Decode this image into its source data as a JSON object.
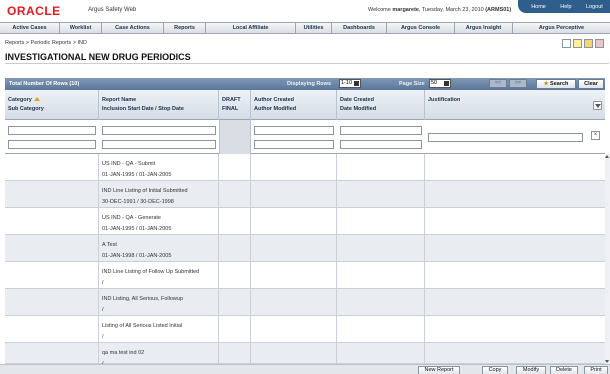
{
  "header": {
    "logo": "ORACLE",
    "app_name": "Argus Safety Web",
    "welcome_prefix": "Welcome ",
    "user": "margarete",
    "date": ", Tuesday, March 23, 2010 ",
    "site": "(ARMS01)",
    "links": [
      "Home",
      "Help",
      "Logout"
    ]
  },
  "menu": [
    "Active Cases",
    "Worklist",
    "Case Actions",
    "Reports",
    "Local Affiliate",
    "Utilities",
    "Dashboards",
    "Argus Console",
    "Argus Insight",
    "Argus Perceptive"
  ],
  "breadcrumb": "Reports > Periodic Reports > IND",
  "page_title": "INVESTIGATIONAL NEW DRUG PERIODICS",
  "grid": {
    "total": "Total Number Of Rows (10)",
    "displaying_label": "Displaying Rows",
    "displaying_value": "1-10",
    "page_size_label": "Page Size",
    "page_size_value": "50",
    "prev": "<<",
    "next": ">>",
    "search": "Search",
    "clear": "Clear",
    "columns": {
      "category": "Category",
      "sub_category": "Sub Category",
      "report_name": "Report Name",
      "inclusion": "Inclusion Start Date / Stop Date",
      "draft": "DRAFT",
      "final": "FINAL",
      "author_created": "Author Created",
      "author_modified": "Author Modified",
      "date_created": "Date Created",
      "date_modified": "Date Modified",
      "justification": "Justification"
    },
    "rows": [
      {
        "name": "US IND - QA - Submit",
        "dates": "01-JAN-1995 / 01-JAN-2005"
      },
      {
        "name": "IND Line Listing of Initial Submitted",
        "dates": "30-DEC-1991 / 30-DEC-1998"
      },
      {
        "name": "US IND - QA - Generate",
        "dates": "01-JAN-1995 / 01-JAN-2005"
      },
      {
        "name": "A Test",
        "dates": "01-JAN-1998 / 01-JAN-2005"
      },
      {
        "name": "IND Line Listing of Follow Up Submitted",
        "dates": "/"
      },
      {
        "name": "IND Listing, All Serious, Followup",
        "dates": "/"
      },
      {
        "name": "Listing of All Serious Listed Initial",
        "dates": "/"
      },
      {
        "name": "qa ma test ind 02",
        "dates": "/"
      }
    ]
  },
  "footer": {
    "new_report": "New Report",
    "copy": "Copy",
    "modify": "Modify",
    "delete": "Delete",
    "print": "Print"
  }
}
